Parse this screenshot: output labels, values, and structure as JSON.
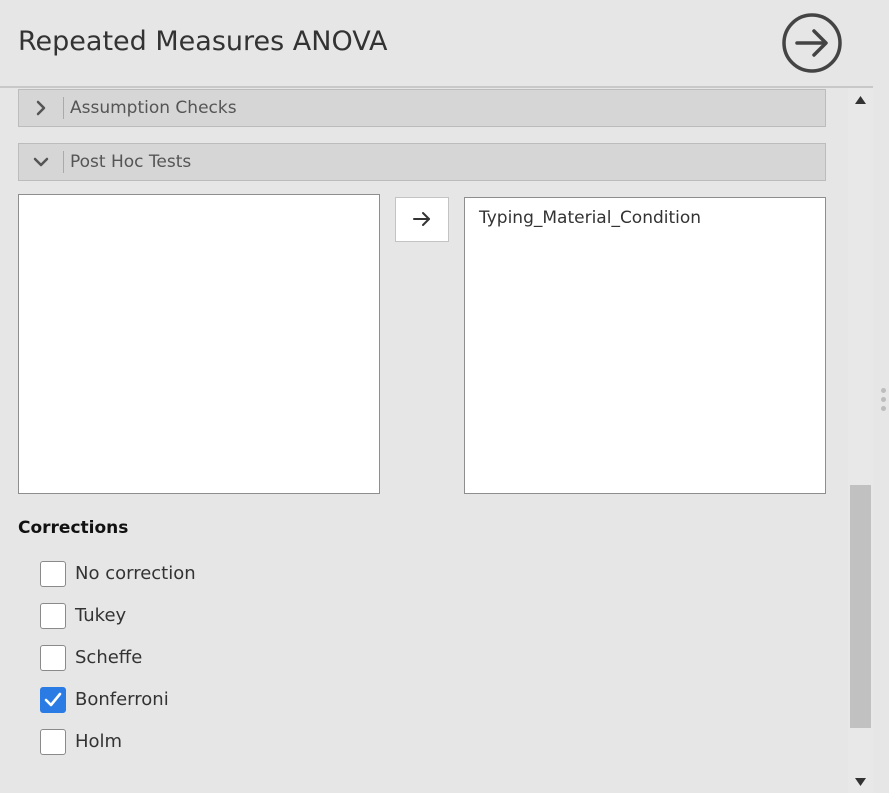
{
  "header": {
    "title": "Repeated Measures ANOVA",
    "go_icon": "circle-arrow-right-icon"
  },
  "sections": [
    {
      "label": "Assumption Checks",
      "expanded": false,
      "icon": "chevron-right-icon"
    },
    {
      "label": "Post Hoc Tests",
      "expanded": true,
      "icon": "chevron-down-icon"
    }
  ],
  "post_hoc": {
    "available_items": [],
    "move_icon": "arrow-right-icon",
    "selected_items": [
      "Typing_Material_Condition"
    ]
  },
  "corrections": {
    "title": "Corrections",
    "options": [
      {
        "label": "No correction",
        "checked": false
      },
      {
        "label": "Tukey",
        "checked": false
      },
      {
        "label": "Scheffe",
        "checked": false
      },
      {
        "label": "Bonferroni",
        "checked": true
      },
      {
        "label": "Holm",
        "checked": false
      }
    ]
  },
  "colors": {
    "checkbox_checked": "#2a7be4",
    "panel_background": "#e6e6e6"
  }
}
